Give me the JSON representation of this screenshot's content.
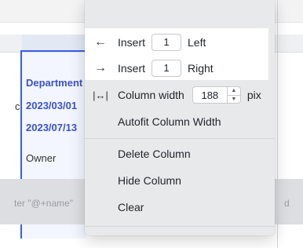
{
  "sheet": {
    "left_cut_letter": "c",
    "col_cells": [
      "Department",
      "2023/03/01",
      "2023/07/13"
    ],
    "owner_cell": "Owner",
    "mention_placeholder": "ter \"@+name\"",
    "right_cut_letter": "d"
  },
  "menu": {
    "insert_left": {
      "label": "Insert",
      "count": "1",
      "side": "Left"
    },
    "insert_right": {
      "label": "Insert",
      "count": "1",
      "side": "Right"
    },
    "column_width": {
      "label": "Column width",
      "value": "188",
      "unit": "pix"
    },
    "autofit": "Autofit Column Width",
    "delete": "Delete Column",
    "hide": "Hide Column",
    "clear": "Clear",
    "clear_chevron": ">"
  },
  "colors": {
    "selection_blue": "#3b5ee0",
    "header_text_blue": "#3a52c8",
    "menu_bg": "#e8e9eb",
    "highlight_bg": "#ffffff"
  }
}
